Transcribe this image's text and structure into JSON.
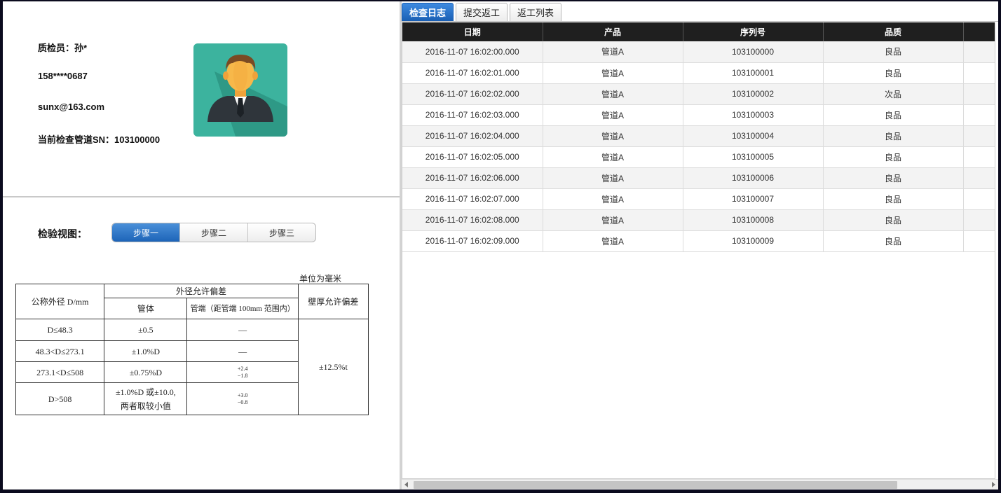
{
  "inspector": {
    "name_line": "质检员：孙*",
    "phone": "158****0687",
    "email": "sunx@163.com",
    "pipe_sn_line": "当前检查管道SN：103100000"
  },
  "view": {
    "label": "检验视图：",
    "steps": [
      "步骤一",
      "步骤二",
      "步骤三"
    ],
    "active_step": 0
  },
  "spec_table": {
    "unit_note": "单位为毫米",
    "col_nominal": "公称外径 D/mm",
    "col_od_tolerance": "外径允许偏差",
    "col_pipe_body": "管体",
    "col_pipe_end": "管端（距管端 100mm 范围内）",
    "col_wall": "壁厚允许偏差",
    "rows": [
      {
        "d": "D≤48.3",
        "body": "±0.5",
        "end": "—"
      },
      {
        "d": "48.3<D≤273.1",
        "body": "±1.0%D",
        "end": "—"
      },
      {
        "d": "273.1<D≤508",
        "body": "±0.75%D",
        "end_plus": "+2.4",
        "end_minus": "−1.8"
      },
      {
        "d": "D>508",
        "body_1": "±1.0%D 或±10.0,",
        "body_2": "两者取较小值",
        "end_plus": "+3.0",
        "end_minus": "−0.8"
      }
    ],
    "wall_tolerance": "±12.5%t"
  },
  "tabs": [
    "检查日志",
    "提交返工",
    "返工列表"
  ],
  "active_tab": 0,
  "log_table": {
    "headers": [
      "日期",
      "产品",
      "序列号",
      "品质",
      ""
    ],
    "rows": [
      [
        "2016-11-07 16:02:00.000",
        "管道A",
        "103100000",
        "良品"
      ],
      [
        "2016-11-07 16:02:01.000",
        "管道A",
        "103100001",
        "良品"
      ],
      [
        "2016-11-07 16:02:02.000",
        "管道A",
        "103100002",
        "次品"
      ],
      [
        "2016-11-07 16:02:03.000",
        "管道A",
        "103100003",
        "良品"
      ],
      [
        "2016-11-07 16:02:04.000",
        "管道A",
        "103100004",
        "良品"
      ],
      [
        "2016-11-07 16:02:05.000",
        "管道A",
        "103100005",
        "良品"
      ],
      [
        "2016-11-07 16:02:06.000",
        "管道A",
        "103100006",
        "良品"
      ],
      [
        "2016-11-07 16:02:07.000",
        "管道A",
        "103100007",
        "良品"
      ],
      [
        "2016-11-07 16:02:08.000",
        "管道A",
        "103100008",
        "良品"
      ],
      [
        "2016-11-07 16:02:09.000",
        "管道A",
        "103100009",
        "良品"
      ]
    ]
  },
  "colors": {
    "accent": "#1d64b8",
    "avatar_bg": "#3cb39e",
    "header_bg": "#1f1f1f"
  }
}
